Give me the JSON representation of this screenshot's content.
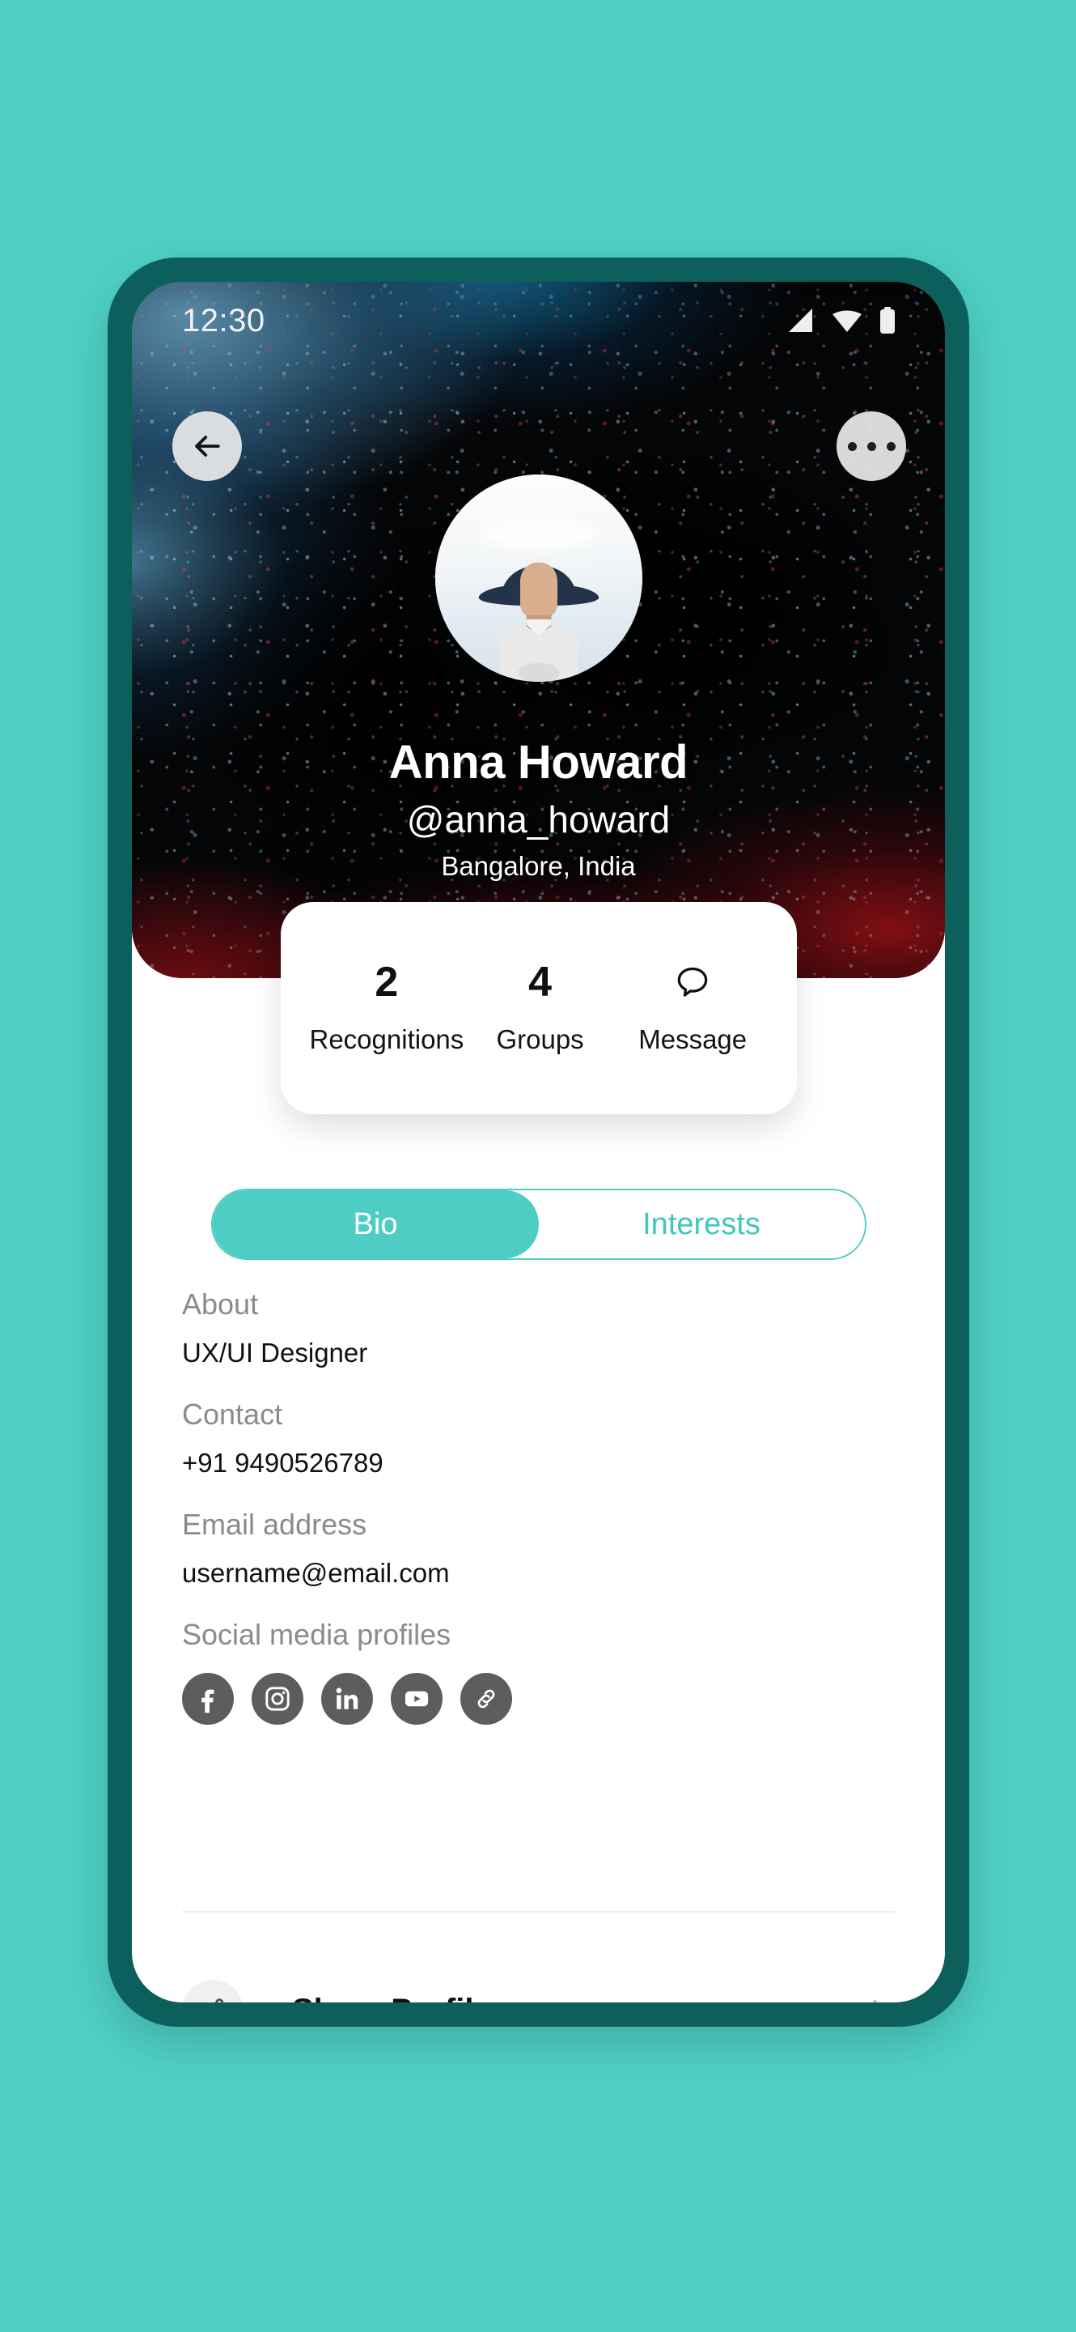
{
  "theme": {
    "page_background": "#4FD1C5",
    "device_bezel": "#0C5F5B",
    "accent": "#4ECDC4",
    "accent_text": "#3FC6BD",
    "muted_text": "#8B8B8B",
    "primary_text": "#111111"
  },
  "status_bar": {
    "time": "12:30",
    "icons": [
      "signal-icon",
      "wifi-icon",
      "battery-icon"
    ]
  },
  "header": {
    "back_icon": "arrow-left-icon",
    "more_icon": "more-horizontal-icon",
    "cover_image_alt": "abstract-fluid-art-cover"
  },
  "profile": {
    "avatar_alt": "user-avatar-photo",
    "name": "Anna Howard",
    "handle": "@anna_howard",
    "location": "Bangalore, India"
  },
  "stats": [
    {
      "value": "2",
      "label": "Recognitions",
      "icon": null
    },
    {
      "value": "4",
      "label": "Groups",
      "icon": null
    },
    {
      "value": null,
      "label": "Message",
      "icon": "chat-bubble-icon"
    }
  ],
  "tabs": [
    {
      "label": "Bio",
      "active": true
    },
    {
      "label": "Interests",
      "active": false
    }
  ],
  "bio": {
    "about": {
      "label": "About",
      "value": "UX/UI Designer"
    },
    "contact": {
      "label": "Contact",
      "value": "+91 9490526789"
    },
    "email": {
      "label": "Email address",
      "value": "username@email.com"
    },
    "social": {
      "label": "Social media profiles",
      "items": [
        {
          "name": "facebook-icon"
        },
        {
          "name": "instagram-icon"
        },
        {
          "name": "linkedin-icon"
        },
        {
          "name": "youtube-icon"
        },
        {
          "name": "link-icon"
        }
      ]
    }
  },
  "share": {
    "icon": "share-icon",
    "label": "Share Profile",
    "chevron": "chevron-right-icon"
  }
}
